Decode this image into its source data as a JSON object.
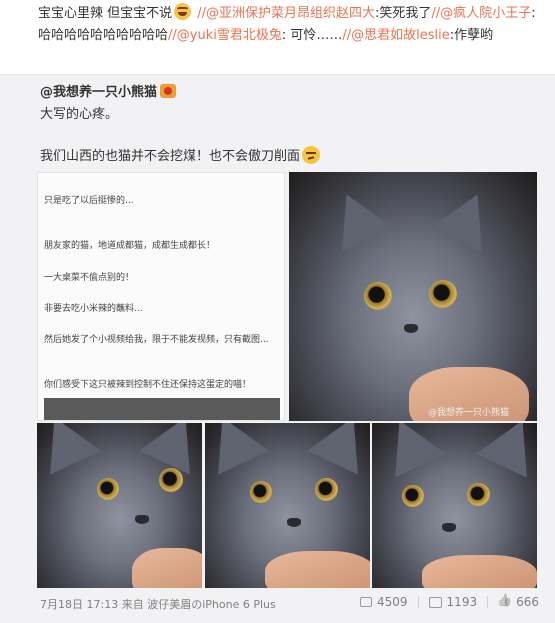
{
  "repost": {
    "text_start": "宝宝心里辣 但宝宝不说",
    "link1": "//@亚洲保护菜月昂组织赵四大",
    "text1": ":笑死我了",
    "link2": "//@疯人院小王子",
    "text2": ":哈哈哈哈哈哈哈哈哈哈",
    "link3": "//@yuki雪君北极兔",
    "text3": ": 可怜……",
    "link4": "//@思君如故leslie",
    "text4": ":作孽哟"
  },
  "original": {
    "author": "@我想养一只小熊猫",
    "line1": "大写的心疼。",
    "line2": "我们山西的也猫并不会挖煤！也不会傲刀削面",
    "chat_lines": [
      "只是吃了以后挺惨的...",
      "朋友家的猫，地道成都猫，成都生成都长！",
      "一大桌菜不偷点别的！",
      "非要去吃小米辣的蘸料...",
      "然后她发了个小视频给我，限于不能发视频，只有截图...",
      "你们感受下这只被辣到控制不住还保持这蛋定的喵！"
    ],
    "watermark": "@我想养一只小熊猫"
  },
  "footer": {
    "date": "7月18日 17:13",
    "from_label": "来自",
    "source": "波仔美眉のiPhone 6 Plus",
    "reposts": "4509",
    "comments": "1193",
    "likes": "666"
  },
  "icons": [
    "laugh-emoji-icon",
    "badge-icon",
    "thinking-emoji-icon",
    "repost-icon",
    "comment-icon",
    "like-icon"
  ]
}
